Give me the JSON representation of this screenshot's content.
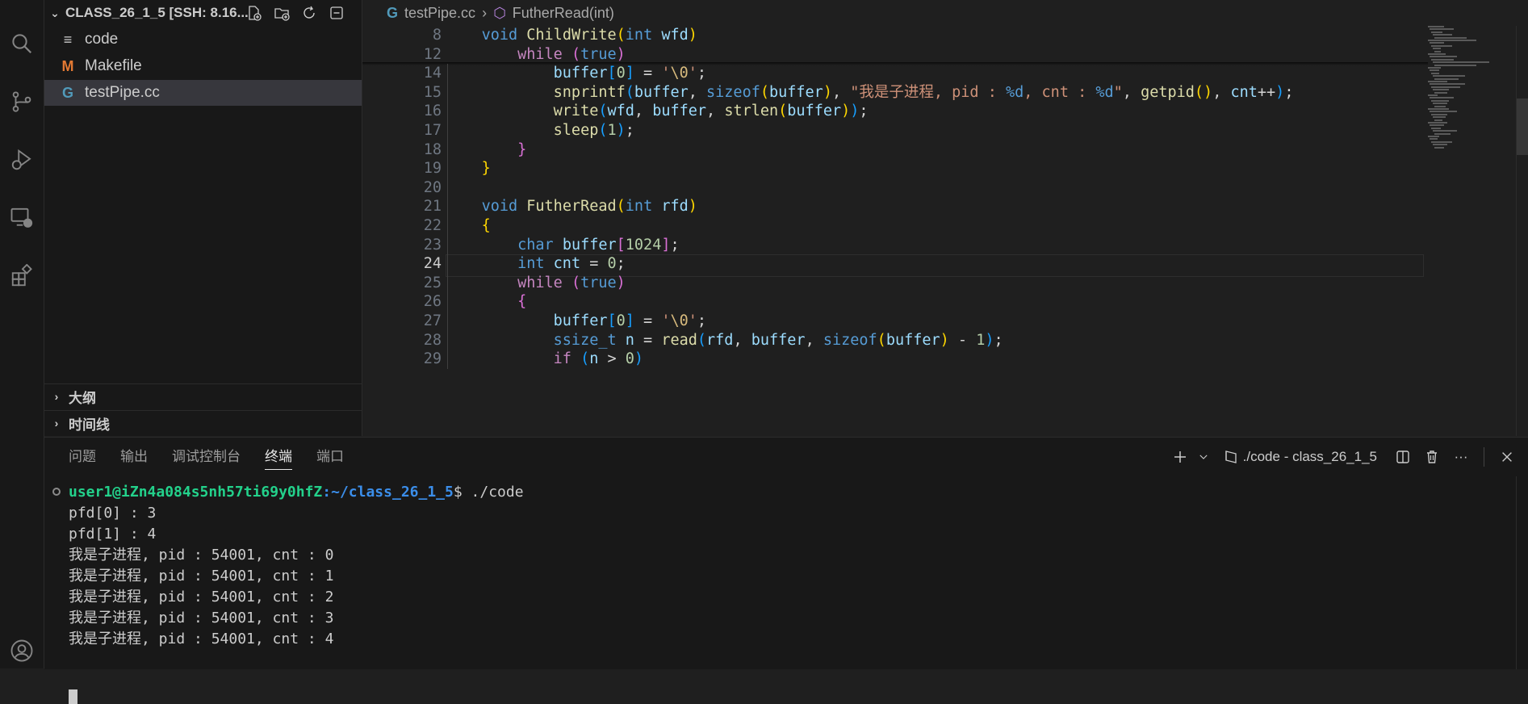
{
  "activity_bar": {
    "icons": [
      "search-icon",
      "source-control-icon",
      "run-debug-icon",
      "remote-explorer-icon",
      "extensions-icon",
      "account-icon"
    ]
  },
  "explorer": {
    "title": "CLASS_26_1_5 [SSH: 8.16...",
    "files": [
      {
        "name": "code",
        "icon": "≡",
        "color": "#cccccc"
      },
      {
        "name": "Makefile",
        "icon": "M",
        "color": "#e37933"
      },
      {
        "name": "testPipe.cc",
        "icon": "G",
        "color": "#519aba"
      }
    ],
    "sections": [
      "大纲",
      "时间线"
    ]
  },
  "breadcrumb": {
    "file": "testPipe.cc",
    "symbol": "FutherRead(int)"
  },
  "code": {
    "current_line": "24",
    "lines": [
      {
        "n": "8",
        "tokens": [
          [
            "",
            "    "
          ],
          [
            "k",
            "void"
          ],
          [
            "o",
            " "
          ],
          [
            "f",
            "ChildWrite"
          ],
          [
            "p1",
            "("
          ],
          [
            "k",
            "int"
          ],
          [
            "o",
            " "
          ],
          [
            "v",
            "wfd"
          ],
          [
            "p1",
            ")"
          ]
        ]
      },
      {
        "n": "12",
        "tokens": [
          [
            "",
            "        "
          ],
          [
            "c",
            "while"
          ],
          [
            "o",
            " "
          ],
          [
            "p2",
            "("
          ],
          [
            "k",
            "true"
          ],
          [
            "p2",
            ")"
          ]
        ]
      },
      {
        "n": "14",
        "tokens": [
          [
            "",
            "            "
          ],
          [
            "v",
            "buffer"
          ],
          [
            "p3",
            "["
          ],
          [
            "n",
            "0"
          ],
          [
            "p3",
            "]"
          ],
          [
            "o",
            " = "
          ],
          [
            "s",
            "'"
          ],
          [
            "e",
            "\\0"
          ],
          [
            "s",
            "'"
          ],
          [
            "o",
            ";"
          ]
        ]
      },
      {
        "n": "15",
        "tokens": [
          [
            "",
            "            "
          ],
          [
            "f",
            "snprintf"
          ],
          [
            "p3",
            "("
          ],
          [
            "v",
            "buffer"
          ],
          [
            "o",
            ", "
          ],
          [
            "k",
            "sizeof"
          ],
          [
            "p1",
            "("
          ],
          [
            "v",
            "buffer"
          ],
          [
            "p1",
            ")"
          ],
          [
            "o",
            ", "
          ],
          [
            "s",
            "\"我是子进程, pid : "
          ],
          [
            "k",
            "%d"
          ],
          [
            "s",
            ", cnt : "
          ],
          [
            "k",
            "%d"
          ],
          [
            "s",
            "\""
          ],
          [
            "o",
            ", "
          ],
          [
            "f",
            "getpid"
          ],
          [
            "p1",
            "()"
          ],
          [
            "o",
            ", "
          ],
          [
            "v",
            "cnt"
          ],
          [
            "o",
            "++"
          ],
          [
            "p3",
            ")"
          ],
          [
            "o",
            ";"
          ]
        ]
      },
      {
        "n": "16",
        "tokens": [
          [
            "",
            "            "
          ],
          [
            "f",
            "write"
          ],
          [
            "p3",
            "("
          ],
          [
            "v",
            "wfd"
          ],
          [
            "o",
            ", "
          ],
          [
            "v",
            "buffer"
          ],
          [
            "o",
            ", "
          ],
          [
            "f",
            "strlen"
          ],
          [
            "p1",
            "("
          ],
          [
            "v",
            "buffer"
          ],
          [
            "p1",
            ")"
          ],
          [
            "p3",
            ")"
          ],
          [
            "o",
            ";"
          ]
        ]
      },
      {
        "n": "17",
        "tokens": [
          [
            "",
            "            "
          ],
          [
            "f",
            "sleep"
          ],
          [
            "p3",
            "("
          ],
          [
            "n",
            "1"
          ],
          [
            "p3",
            ")"
          ],
          [
            "o",
            ";"
          ]
        ]
      },
      {
        "n": "18",
        "tokens": [
          [
            "",
            "        "
          ],
          [
            "p2",
            "}"
          ]
        ]
      },
      {
        "n": "19",
        "tokens": [
          [
            "",
            "    "
          ],
          [
            "p1",
            "}"
          ]
        ]
      },
      {
        "n": "20",
        "tokens": []
      },
      {
        "n": "21",
        "tokens": [
          [
            "",
            "    "
          ],
          [
            "k",
            "void"
          ],
          [
            "o",
            " "
          ],
          [
            "f",
            "FutherRead"
          ],
          [
            "p1",
            "("
          ],
          [
            "k",
            "int"
          ],
          [
            "o",
            " "
          ],
          [
            "v",
            "rfd"
          ],
          [
            "p1",
            ")"
          ]
        ]
      },
      {
        "n": "22",
        "tokens": [
          [
            "",
            "    "
          ],
          [
            "p1",
            "{"
          ]
        ]
      },
      {
        "n": "23",
        "tokens": [
          [
            "",
            "        "
          ],
          [
            "k",
            "char"
          ],
          [
            "o",
            " "
          ],
          [
            "v",
            "buffer"
          ],
          [
            "p2",
            "["
          ],
          [
            "n",
            "1024"
          ],
          [
            "p2",
            "]"
          ],
          [
            "o",
            ";"
          ]
        ]
      },
      {
        "n": "24",
        "tokens": [
          [
            "",
            "        "
          ],
          [
            "k",
            "int"
          ],
          [
            "o",
            " "
          ],
          [
            "v",
            "cnt"
          ],
          [
            "o",
            " = "
          ],
          [
            "n",
            "0"
          ],
          [
            "o",
            ";"
          ]
        ]
      },
      {
        "n": "25",
        "tokens": [
          [
            "",
            "        "
          ],
          [
            "c",
            "while"
          ],
          [
            "o",
            " "
          ],
          [
            "p2",
            "("
          ],
          [
            "k",
            "true"
          ],
          [
            "p2",
            ")"
          ]
        ]
      },
      {
        "n": "26",
        "tokens": [
          [
            "",
            "        "
          ],
          [
            "p2",
            "{"
          ]
        ]
      },
      {
        "n": "27",
        "tokens": [
          [
            "",
            "            "
          ],
          [
            "v",
            "buffer"
          ],
          [
            "p3",
            "["
          ],
          [
            "n",
            "0"
          ],
          [
            "p3",
            "]"
          ],
          [
            "o",
            " = "
          ],
          [
            "s",
            "'"
          ],
          [
            "e",
            "\\0"
          ],
          [
            "s",
            "'"
          ],
          [
            "o",
            ";"
          ]
        ]
      },
      {
        "n": "28",
        "tokens": [
          [
            "",
            "            "
          ],
          [
            "k",
            "ssize_t"
          ],
          [
            "o",
            " "
          ],
          [
            "v",
            "n"
          ],
          [
            "o",
            " = "
          ],
          [
            "f",
            "read"
          ],
          [
            "p3",
            "("
          ],
          [
            "v",
            "rfd"
          ],
          [
            "o",
            ", "
          ],
          [
            "v",
            "buffer"
          ],
          [
            "o",
            ", "
          ],
          [
            "k",
            "sizeof"
          ],
          [
            "p1",
            "("
          ],
          [
            "v",
            "buffer"
          ],
          [
            "p1",
            ")"
          ],
          [
            "o",
            " - "
          ],
          [
            "n",
            "1"
          ],
          [
            "p3",
            ")"
          ],
          [
            "o",
            ";"
          ]
        ]
      },
      {
        "n": "29",
        "tokens": [
          [
            "",
            "            "
          ],
          [
            "c",
            "if"
          ],
          [
            "o",
            " "
          ],
          [
            "p3",
            "("
          ],
          [
            "v",
            "n"
          ],
          [
            "o",
            " > "
          ],
          [
            "n",
            "0"
          ],
          [
            "p3",
            ")"
          ]
        ]
      }
    ]
  },
  "panel": {
    "tabs": [
      "问题",
      "输出",
      "调试控制台",
      "终端",
      "端口"
    ],
    "active_tab": "终端",
    "terminal_name": "./code - class_26_1_5",
    "prompt_user": "user1@iZn4a084s5nh57ti69y0hfZ",
    "prompt_path": ":~/class_26_1_5",
    "prompt_cmd": "$ ./code",
    "output": [
      "pfd[0] : 3",
      "pfd[1] : 4",
      "我是子进程, pid : 54001, cnt : 0",
      "我是子进程, pid : 54001, cnt : 1",
      "我是子进程, pid : 54001, cnt : 2",
      "我是子进程, pid : 54001, cnt : 3",
      "我是子进程, pid : 54001, cnt : 4"
    ]
  }
}
